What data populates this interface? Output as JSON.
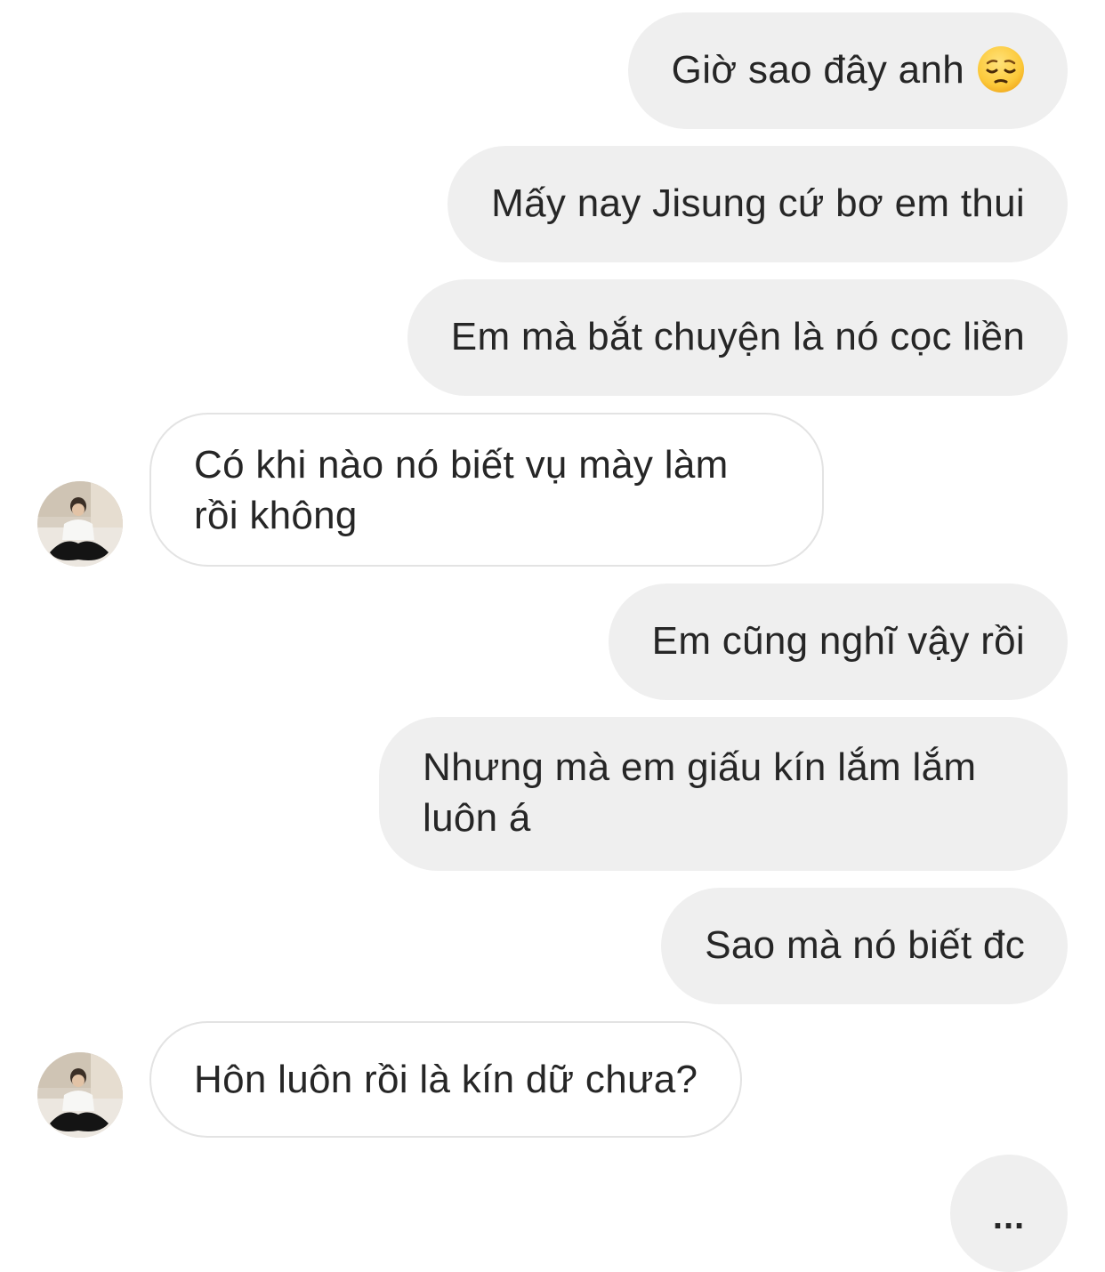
{
  "messages": [
    {
      "sender": "me",
      "text": "Giờ sao đây anh",
      "emoji": "pensive-face"
    },
    {
      "sender": "me",
      "text": "Mấy nay Jisung cứ bơ em thui"
    },
    {
      "sender": "me",
      "text": "Em mà bắt chuyện là nó cọc liền"
    },
    {
      "sender": "them",
      "text": "Có khi nào nó biết vụ mày làm rồi không"
    },
    {
      "sender": "me",
      "text": "Em cũng nghĩ vậy rồi"
    },
    {
      "sender": "me",
      "text": "Nhưng mà em giấu kín lắm lắm luôn á"
    },
    {
      "sender": "me",
      "text": "Sao mà nó biết đc"
    },
    {
      "sender": "them",
      "text": "Hôn luôn rồi là kín dữ chưa?"
    }
  ],
  "typing_indicator": "...",
  "colors": {
    "outgoing_bubble": "#efefef",
    "incoming_border": "#e3e3e3",
    "text": "#262626"
  }
}
